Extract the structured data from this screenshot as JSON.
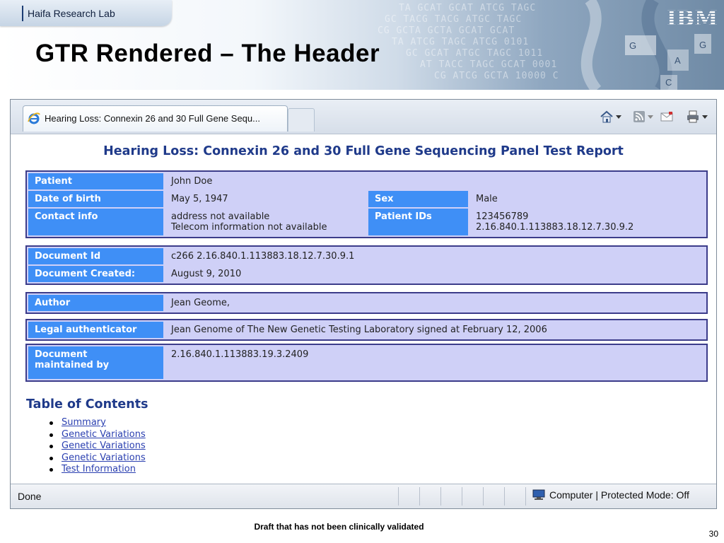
{
  "slide": {
    "lab_name": "Haifa Research Lab",
    "title": "GTR Rendered – The Header",
    "footer_note": "Draft that has not been clinically validated",
    "page_number": "30",
    "logo_text": "IBM"
  },
  "browser": {
    "tab_title": "Hearing Loss: Connexin 26 and 30 Full Gene Sequ...",
    "toolbar_icons": [
      "home-icon",
      "feeds-icon",
      "mail-icon",
      "print-icon"
    ],
    "status_text": "Done",
    "zone_text": "Computer | Protected Mode: Off"
  },
  "report": {
    "title": "Hearing Loss: Connexin 26 and 30 Full Gene Sequencing Panel Test Report",
    "patient": {
      "patient_label": "Patient",
      "patient_value": "John Doe",
      "dob_label": "Date of birth",
      "dob_value": "May 5, 1947",
      "sex_label": "Sex",
      "sex_value": "Male",
      "contact_label": "Contact info",
      "contact_line1": "address not available",
      "contact_line2": "Telecom information not available",
      "ids_label": "Patient IDs",
      "ids_line1": "123456789",
      "ids_line2": "2.16.840.1.113883.18.12.7.30.9.2"
    },
    "document": {
      "id_label": "Document Id",
      "id_value": "c266 2.16.840.1.113883.18.12.7.30.9.1",
      "created_label": "Document Created:",
      "created_value": "August 9, 2010"
    },
    "author": {
      "label": "Author",
      "value": "Jean Geome,"
    },
    "legal": {
      "label": "Legal authenticator",
      "value": "Jean Genome of The New Genetic Testing Laboratory signed at February 12, 2006"
    },
    "maintained": {
      "label_line1": "Document",
      "label_line2": "maintained by",
      "value": "2.16.840.1.113883.19.3.2409"
    },
    "toc": {
      "heading": "Table of Contents",
      "items": [
        "Summary",
        "Genetic Variations",
        "Genetic Variations",
        "Genetic Variations",
        "Test Information"
      ]
    }
  },
  "colors": {
    "label_bg": "#3f8ff6",
    "value_bg": "#cfd0f7",
    "border": "#3c3c8a",
    "heading": "#1f3a8a"
  }
}
